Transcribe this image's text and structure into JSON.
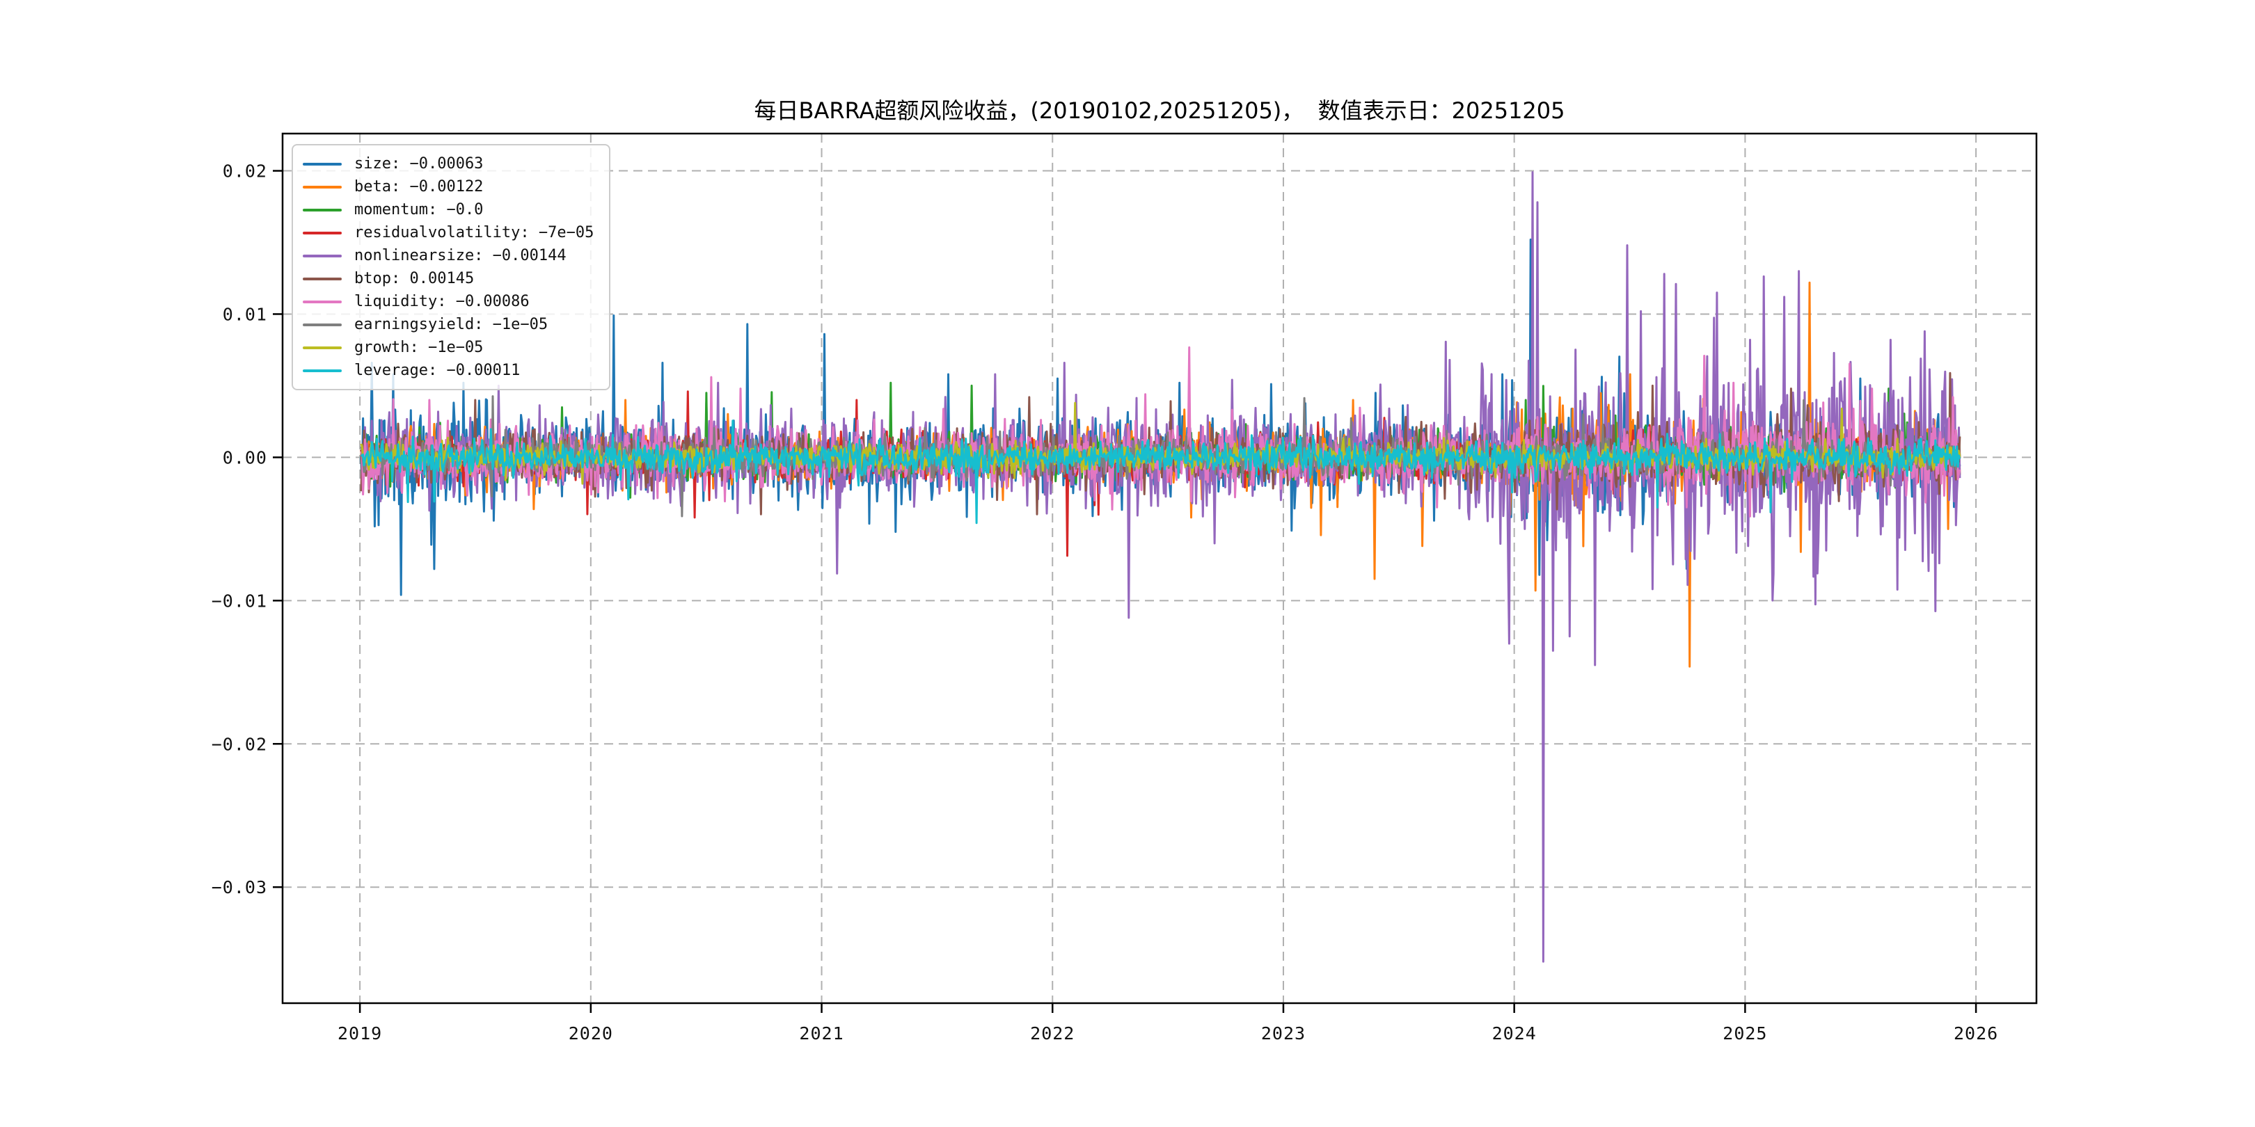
{
  "title": "每日BARRA超额风险收益，(20190102,20251205)，  数值表示日：20251205",
  "colors": {
    "background": "#ffffff",
    "axis": "#000000",
    "grid": "#b0b0b0",
    "text": "#111111",
    "legend_border": "#cccccc"
  },
  "chart_data": {
    "type": "line",
    "title": "每日BARRA超额风险收益，(20190102,20251205)，  数值表示日：20251205",
    "date_range": [
      "20190102",
      "20251205"
    ],
    "value_label_date": "20251205",
    "grid": "dashed",
    "legend_position": "upper-left",
    "xlabel": "",
    "ylabel": "",
    "xlim": [
      2018.665,
      2026.262
    ],
    "ylim": [
      -0.0381,
      0.0226
    ],
    "xtick_values": [
      2019,
      2020,
      2021,
      2022,
      2023,
      2024,
      2025,
      2026
    ],
    "xtick_labels": [
      "2019",
      "2020",
      "2021",
      "2022",
      "2023",
      "2024",
      "2025",
      "2026"
    ],
    "ytick_values": [
      0.02,
      0.01,
      0.0,
      -0.01,
      -0.02,
      -0.03
    ],
    "ytick_labels": [
      "0.02",
      "0.01",
      "0.00",
      "−0.01",
      "−0.02",
      "−0.03"
    ],
    "x_start": 2019.005,
    "x_end": 2025.93,
    "n_points": 1640,
    "series": [
      {
        "name": "size",
        "color": "#1f77b4",
        "legend_label": "size: −0.00063",
        "last_value": -0.00063,
        "seed": 101,
        "eras": [
          [
            2019.0,
            2019.6,
            0.0021
          ],
          [
            2019.6,
            2023.95,
            0.00135
          ],
          [
            2023.95,
            2024.6,
            0.0021
          ],
          [
            2024.6,
            2026.3,
            0.00125
          ]
        ],
        "events": [
          [
            2019.05,
            0.0066
          ],
          [
            2019.18,
            -0.0096
          ],
          [
            2019.31,
            -0.0061
          ],
          [
            2019.45,
            0.0052
          ],
          [
            2020.1,
            0.0099
          ],
          [
            2020.31,
            0.0066
          ],
          [
            2020.68,
            0.0093
          ],
          [
            2021.01,
            0.0086
          ],
          [
            2021.32,
            -0.0052
          ],
          [
            2021.55,
            0.0058
          ],
          [
            2022.02,
            0.0055
          ],
          [
            2022.55,
            0.0052
          ],
          [
            2023.4,
            0.0045
          ],
          [
            2023.95,
            0.0058
          ],
          [
            2024.07,
            0.0152
          ],
          [
            2024.11,
            -0.0082
          ],
          [
            2025.5,
            0.0055
          ]
        ]
      },
      {
        "name": "beta",
        "color": "#ff7f0e",
        "legend_label": "beta: −0.00122",
        "last_value": -0.00122,
        "seed": 202,
        "eras": [
          [
            2019.0,
            2023.95,
            0.00085
          ],
          [
            2023.95,
            2025.0,
            0.0016
          ],
          [
            2025.0,
            2026.3,
            0.0012
          ]
        ],
        "events": [
          [
            2020.15,
            0.004
          ],
          [
            2022.6,
            -0.0042
          ],
          [
            2023.3,
            0.004
          ],
          [
            2024.09,
            -0.0093
          ],
          [
            2024.3,
            -0.0062
          ],
          [
            2024.5,
            0.0058
          ],
          [
            2024.76,
            -0.0146
          ],
          [
            2025.24,
            -0.0066
          ],
          [
            2025.28,
            0.0122
          ],
          [
            2025.88,
            -0.005
          ]
        ]
      },
      {
        "name": "momentum",
        "color": "#2ca02c",
        "legend_label": "momentum: −0.0",
        "last_value": -2e-05,
        "seed": 303,
        "eras": [
          [
            2019.0,
            2024.0,
            0.0007
          ],
          [
            2024.0,
            2026.3,
            0.00095
          ]
        ],
        "events": [
          [
            2020.5,
            0.0045
          ],
          [
            2021.3,
            0.0052
          ],
          [
            2021.65,
            0.005
          ],
          [
            2024.05,
            0.004
          ],
          [
            2025.62,
            0.0048
          ],
          [
            2025.66,
            -0.0055
          ]
        ]
      },
      {
        "name": "residualvolatility",
        "color": "#d62728",
        "legend_label": "residualvolatility: −7e−05",
        "last_value": -7e-05,
        "seed": 404,
        "eras": [
          [
            2019.0,
            2026.3,
            0.0007
          ]
        ],
        "events": [
          [
            2020.42,
            0.0046
          ],
          [
            2020.45,
            -0.0042
          ],
          [
            2021.15,
            0.004
          ],
          [
            2022.2,
            -0.004
          ],
          [
            2024.1,
            0.0042
          ],
          [
            2024.13,
            -0.0048
          ]
        ]
      },
      {
        "name": "nonlinearsize",
        "color": "#9467bd",
        "legend_label": "nonlinearsize: −0.00144",
        "last_value": -0.00144,
        "seed": 505,
        "eras": [
          [
            2019.0,
            2020.0,
            0.00125
          ],
          [
            2020.0,
            2023.8,
            0.00145
          ],
          [
            2023.8,
            2026.3,
            0.0031
          ]
        ],
        "events": [
          [
            2019.6,
            0.005
          ],
          [
            2020.55,
            0.0052
          ],
          [
            2021.75,
            0.0058
          ],
          [
            2022.05,
            0.0066
          ],
          [
            2022.33,
            -0.0112
          ],
          [
            2022.7,
            -0.006
          ],
          [
            2023.72,
            0.0068
          ],
          [
            2024.08,
            0.0199
          ],
          [
            2024.1,
            0.0178
          ],
          [
            2024.125,
            -0.0352
          ],
          [
            2024.17,
            -0.0135
          ],
          [
            2024.24,
            -0.0125
          ],
          [
            2024.35,
            -0.0145
          ],
          [
            2024.49,
            0.0148
          ],
          [
            2024.55,
            0.0102
          ],
          [
            2024.6,
            -0.0092
          ],
          [
            2024.65,
            0.0128
          ],
          [
            2024.7,
            0.0121
          ],
          [
            2024.75,
            -0.0089
          ],
          [
            2024.88,
            0.0115
          ],
          [
            2025.02,
            0.0082
          ],
          [
            2025.17,
            0.0112
          ],
          [
            2025.35,
            -0.0065
          ],
          [
            2025.63,
            0.0082
          ],
          [
            2025.78,
            0.0088
          ]
        ]
      },
      {
        "name": "btop",
        "color": "#8c564b",
        "legend_label": "btop: 0.00145",
        "last_value": 0.00145,
        "seed": 606,
        "eras": [
          [
            2019.0,
            2024.0,
            0.00085
          ],
          [
            2024.0,
            2026.3,
            0.00115
          ]
        ],
        "events": [
          [
            2019.5,
            0.004
          ],
          [
            2021.9,
            0.0042
          ],
          [
            2024.6,
            0.005
          ],
          [
            2025.2,
            0.0048
          ]
        ]
      },
      {
        "name": "liquidity",
        "color": "#e377c2",
        "legend_label": "liquidity: −0.00086",
        "last_value": -0.00086,
        "seed": 707,
        "eras": [
          [
            2019.0,
            2020.4,
            0.001
          ],
          [
            2020.4,
            2024.7,
            0.00105
          ],
          [
            2024.7,
            2026.3,
            0.00135
          ]
        ],
        "events": [
          [
            2019.3,
            0.004
          ],
          [
            2020.52,
            0.0056
          ],
          [
            2020.65,
            0.0048
          ],
          [
            2022.4,
            0.0044
          ],
          [
            2024.95,
            0.0052
          ],
          [
            2025.55,
            0.0048
          ],
          [
            2025.9,
            0.0042
          ]
        ]
      },
      {
        "name": "earningsyield",
        "color": "#7f7f7f",
        "legend_label": "earningsyield: −1e−05",
        "last_value": -1e-05,
        "seed": 808,
        "eras": [
          [
            2019.0,
            2026.3,
            0.0006
          ]
        ],
        "events": [
          [
            2024.3,
            0.003
          ]
        ]
      },
      {
        "name": "growth",
        "color": "#bcbd22",
        "legend_label": "growth: −1e−05",
        "last_value": -1e-05,
        "seed": 909,
        "eras": [
          [
            2019.0,
            2026.3,
            0.00045
          ]
        ],
        "events": []
      },
      {
        "name": "leverage",
        "color": "#17becf",
        "legend_label": "leverage: −0.00011",
        "last_value": -0.00011,
        "seed": 1010,
        "eras": [
          [
            2019.0,
            2026.3,
            0.00055
          ]
        ],
        "events": [
          [
            2024.62,
            -0.0035
          ]
        ]
      }
    ]
  }
}
